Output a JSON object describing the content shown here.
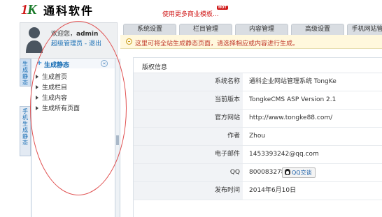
{
  "brand": {
    "logo_k1": "1",
    "logo_k2": "K",
    "name": "通科软件"
  },
  "promo": {
    "text": "使用更多商业模板...",
    "badge": "HOT"
  },
  "user": {
    "welcome": "欢迎您，",
    "username": "admin",
    "role": "超级管理员",
    "separator": " - ",
    "logout": "退出"
  },
  "vertical_tabs": [
    {
      "label": "生成静态"
    },
    {
      "label": "手机生成静态"
    }
  ],
  "sidebar": {
    "header": {
      "plus": "+",
      "title": "生成静态",
      "collapse": "«"
    },
    "items": [
      {
        "label": "生成首页"
      },
      {
        "label": "生成栏目"
      },
      {
        "label": "生成内容"
      },
      {
        "label": "生成所有页面"
      }
    ]
  },
  "tabs": [
    {
      "label": "系统设置"
    },
    {
      "label": "栏目管理"
    },
    {
      "label": "内容管理"
    },
    {
      "label": "高级设置"
    },
    {
      "label": "手机网站管"
    }
  ],
  "notice": {
    "text": "这里可将全站生成静态页面，请选择相应或内容进行生成。"
  },
  "panel": {
    "title": "版权信息",
    "rows": [
      {
        "label": "系统名称",
        "value": "通科企业网站管理系统 TongKe"
      },
      {
        "label": "当前版本",
        "value": "TongkeCMS ASP Version 2.1"
      },
      {
        "label": "官方网站",
        "value": "http://www.tongke88.com/"
      },
      {
        "label": "作者",
        "value": "Zhou"
      },
      {
        "label": "电子邮件",
        "value": "1453393242@qq.com"
      },
      {
        "label": "QQ",
        "value": "800083278",
        "button": "QQ交谈"
      },
      {
        "label": "发布时间",
        "value": "2014年6月10日"
      }
    ]
  },
  "colors": {
    "brand_red": "#d01818",
    "link_blue": "#1a6fb5",
    "notice_red": "#c0392b",
    "annotation_oval": "#e05050"
  }
}
